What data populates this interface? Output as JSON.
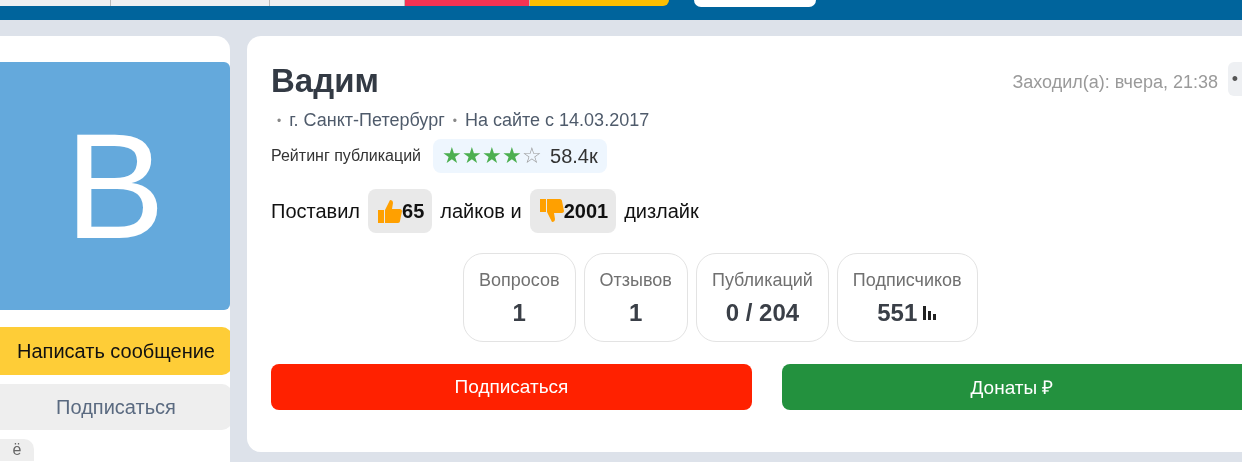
{
  "profile": {
    "name": "Вадим",
    "last_seen": "Заходил(а): вчера, 21:38",
    "more": "•",
    "separator": "•",
    "city": "г. Санкт-Петербург",
    "since": "На сайте с 14.03.2017",
    "avatar_letter": "В"
  },
  "rating": {
    "label": "Рейтинг публикаций",
    "stars": 4,
    "value": "58.4к"
  },
  "votes": {
    "prefix": "Поставил",
    "likes": "65",
    "middle": "лайков и",
    "dislikes": "2001",
    "suffix": "дизлайк"
  },
  "stats": [
    {
      "label": "Вопросов",
      "value": "1",
      "chart": false
    },
    {
      "label": "Отзывов",
      "value": "1",
      "chart": false
    },
    {
      "label": "Публикаций",
      "value": "0 / 204",
      "chart": false
    },
    {
      "label": "Подписчиков",
      "value": "551",
      "chart": true
    }
  ],
  "sidebar_buttons": [
    {
      "label": "Написать сообщение",
      "kind": "primary"
    },
    {
      "label": "Подписаться",
      "kind": "secondary"
    },
    {
      "label": "ё",
      "kind": "chip"
    }
  ],
  "actions": [
    {
      "label": "Подписаться",
      "kind": "subscribe"
    },
    {
      "label": "Донаты ₽",
      "kind": "donate"
    }
  ]
}
